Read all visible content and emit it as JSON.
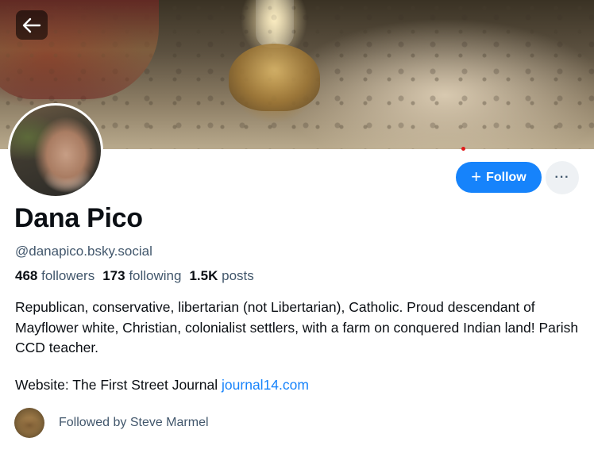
{
  "banner": {
    "description": ""
  },
  "back_button": {
    "icon": "arrow-left-icon"
  },
  "actions": {
    "follow_label": "Follow",
    "follow_icon": "plus-icon",
    "more_label": "···",
    "accent_color": "#1683fb"
  },
  "profile": {
    "display_name": "Dana Pico",
    "handle": "@danapico.bsky.social",
    "followers_count": "468",
    "followers_label": "followers",
    "following_count": "173",
    "following_label": "following",
    "posts_count": "1.5K",
    "posts_label": "posts",
    "bio": "Republican, conservative, libertarian (not Libertarian), Catholic. Proud descendant of Mayflower white, Christian, colonialist settlers, with a farm on conquered Indian land! Parish CCD teacher.",
    "website_prefix": "Website: The First Street Journal",
    "website_link": "journal14.com"
  },
  "followed_by": {
    "text": "Followed by Steve Marmel"
  }
}
